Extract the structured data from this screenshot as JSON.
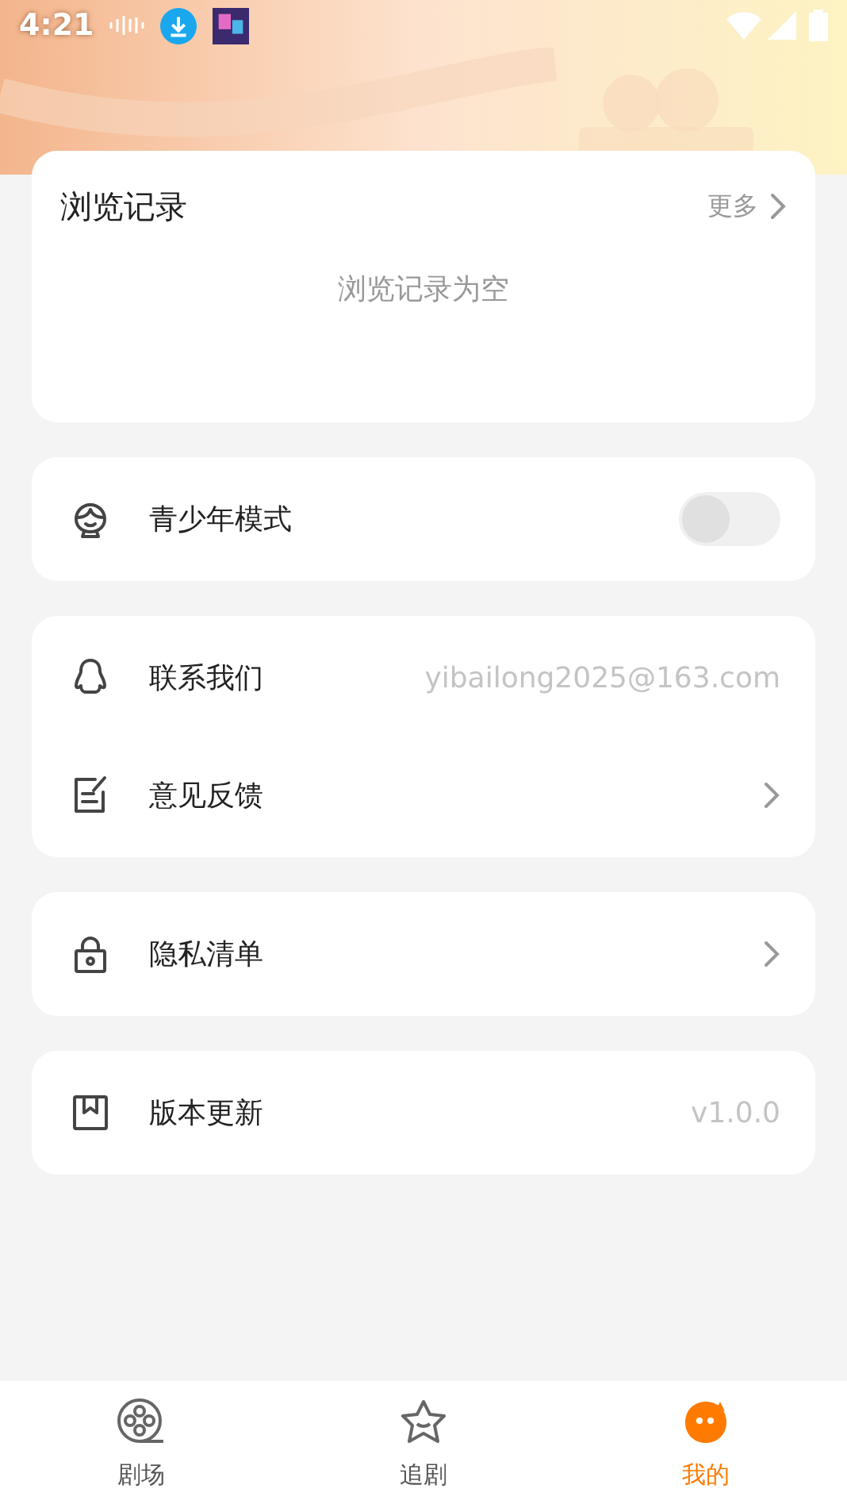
{
  "status_bar": {
    "time": "4:21"
  },
  "history": {
    "title": "浏览记录",
    "more": "更多",
    "empty": "浏览记录为空"
  },
  "groups": [
    {
      "rows": [
        {
          "kind": "toggle",
          "label": "青少年模式",
          "on": false
        }
      ]
    },
    {
      "rows": [
        {
          "kind": "value",
          "label": "联系我们",
          "value": "yibailong2025@163.com"
        },
        {
          "kind": "link",
          "label": "意见反馈"
        }
      ]
    },
    {
      "rows": [
        {
          "kind": "link",
          "label": "隐私清单"
        }
      ]
    },
    {
      "rows": [
        {
          "kind": "value",
          "label": "版本更新",
          "value": "v1.0.0"
        }
      ]
    }
  ],
  "tabs": [
    {
      "label": "剧场",
      "selected": false
    },
    {
      "label": "追剧",
      "selected": false
    },
    {
      "label": "我的",
      "selected": true
    }
  ]
}
